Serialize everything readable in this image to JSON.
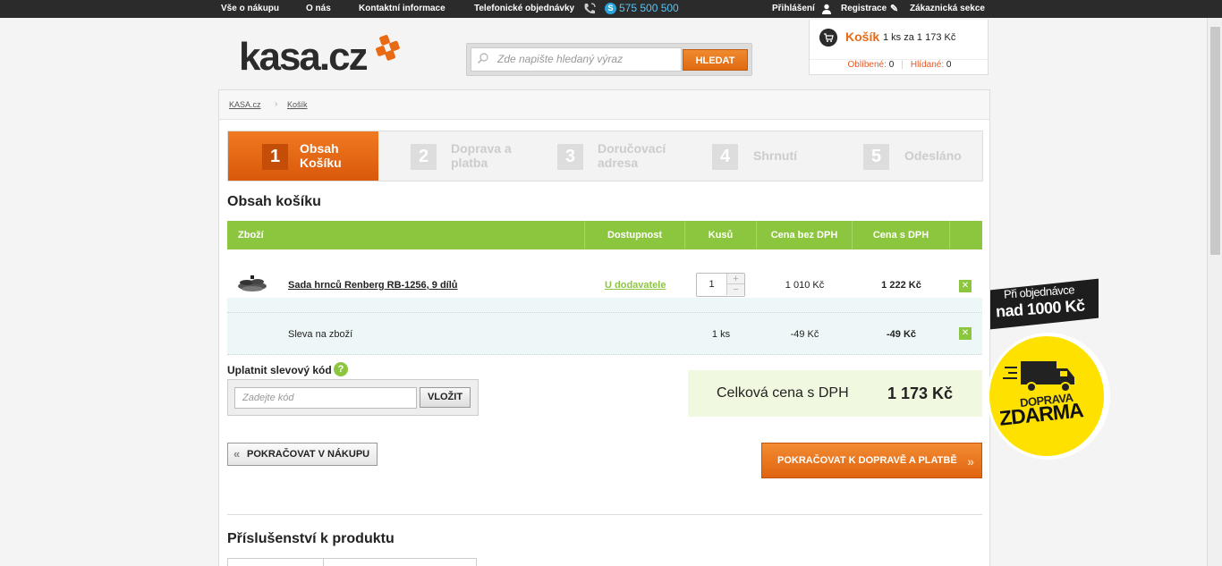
{
  "topbar": {
    "links": [
      "Vše o nákupu",
      "O nás",
      "Kontaktní informace",
      "Telefonické objednávky"
    ],
    "phone": "575 500 500",
    "login": "Přihlášení",
    "register": "Registrace",
    "customer": "Zákaznická sekce"
  },
  "logo": {
    "text": "kasa.cz"
  },
  "search": {
    "placeholder": "Zde napište hledaný výraz",
    "button": "HLEDAT"
  },
  "cart": {
    "title": "Košík",
    "summary": "1 ks za 1 173 Kč",
    "favorites_label": "Oblíbené:",
    "favorites_count": "0",
    "watched_label": "Hlídané:",
    "watched_count": "0"
  },
  "breadcrumb": [
    "KASA.cz",
    "Košík"
  ],
  "steps": [
    {
      "num": "1",
      "label": "Obsah Košíku",
      "active": true
    },
    {
      "num": "2",
      "label": "Doprava a platba",
      "active": false
    },
    {
      "num": "3",
      "label": "Doručovací adresa",
      "active": false
    },
    {
      "num": "4",
      "label": "Shrnutí",
      "active": false
    },
    {
      "num": "5",
      "label": "Odesláno",
      "active": false
    }
  ],
  "section_title": "Obsah košíku",
  "table": {
    "headers": [
      "Zboží",
      "Dostupnost",
      "Kusů",
      "Cena bez DPH",
      "Cena s DPH"
    ],
    "rows": [
      {
        "name": "Sada hrnců Renberg RB-1256, 9 dílů",
        "availability": "U dodavatele",
        "qty": "1",
        "price_no_vat": "1 010 Kč",
        "price_vat": "1 222 Kč"
      },
      {
        "name": "Sleva na zboží",
        "qty": "1 ks",
        "price_no_vat": "-49 Kč",
        "price_vat": "-49 Kč"
      }
    ]
  },
  "coupon": {
    "title": "Uplatnit slevový kód",
    "placeholder": "Zadejte kód",
    "button": "VLOŽIT"
  },
  "total": {
    "label": "Celková cena s DPH",
    "value": "1 173 Kč"
  },
  "buttons": {
    "back": "POKRAČOVAT V NÁKUPU",
    "next": "POKRAČOVAT K DOPRAVĚ A PLATBĚ"
  },
  "accessories_title": "Příslušenství k produktu",
  "promo": {
    "line1": "Při objednávce",
    "line2": "nad 1000 Kč",
    "line3": "DOPRAVA",
    "line4": "ZDARMA"
  },
  "colors": {
    "accent": "#e96a14",
    "green": "#8cc63f",
    "dark": "#2b2b2b",
    "promo_yellow": "#ffe100"
  }
}
